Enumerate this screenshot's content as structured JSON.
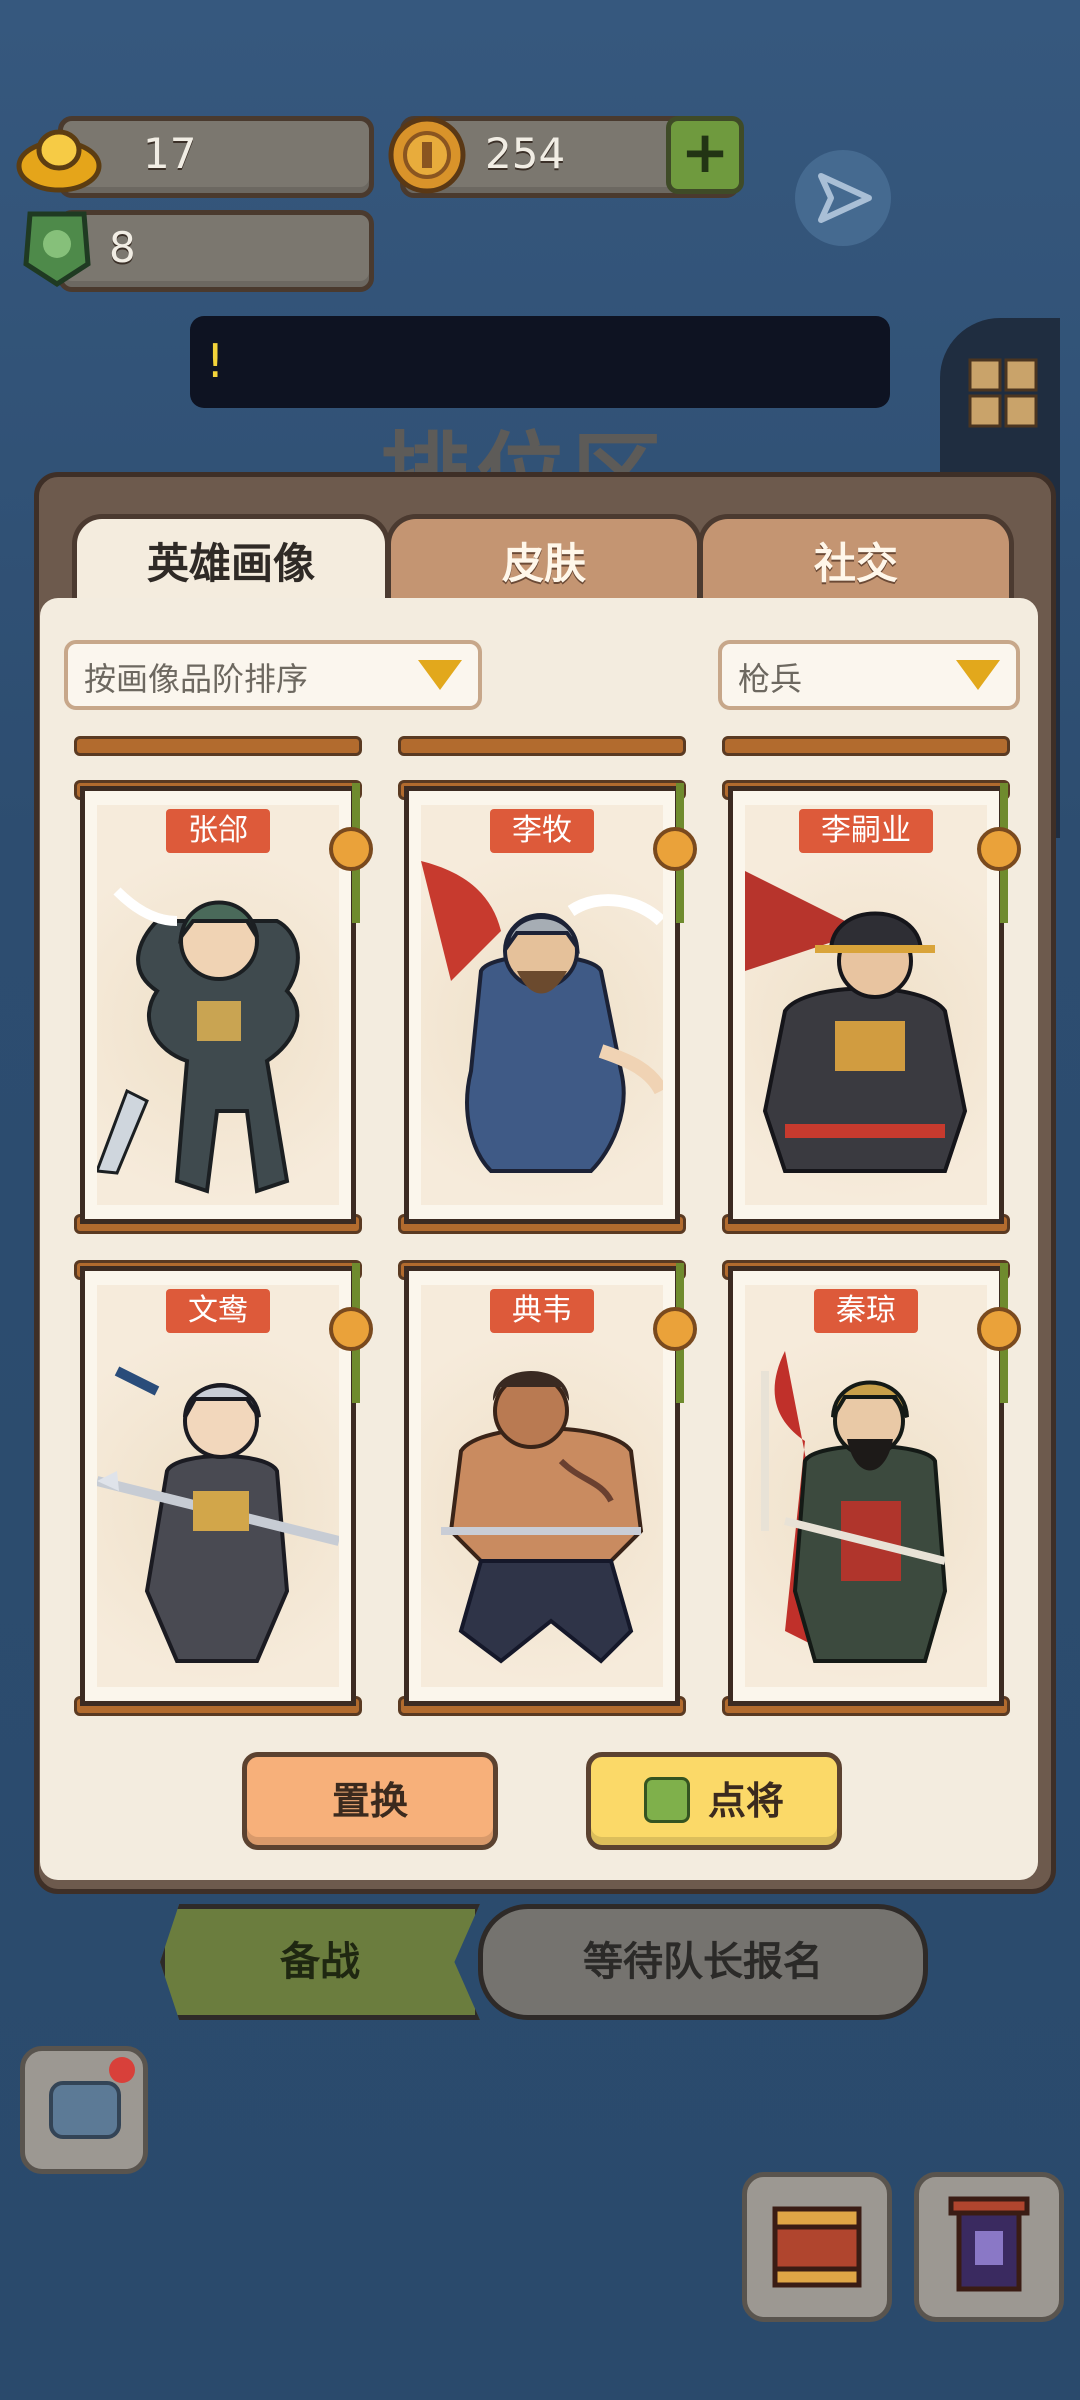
{
  "resources": {
    "gold_ingot": "17",
    "coin": "254",
    "jade": "8"
  },
  "notice": {
    "text": "!"
  },
  "area_title": "排位区",
  "tabs": [
    {
      "label": "英雄画像",
      "active": true
    },
    {
      "label": "皮肤",
      "active": false
    },
    {
      "label": "社交",
      "active": false
    }
  ],
  "filters": {
    "sort": "按画像品阶排序",
    "type": "枪兵"
  },
  "heroes": [
    {
      "name": "张郃"
    },
    {
      "name": "李牧"
    },
    {
      "name": "李嗣业"
    },
    {
      "name": "文鸯"
    },
    {
      "name": "典韦"
    },
    {
      "name": "秦琼"
    }
  ],
  "actions": {
    "replace": "置换",
    "pick": "点将"
  },
  "bottom": {
    "ready": "备战",
    "wait": "等待队长报名"
  },
  "icons": [
    "gold-ingot-icon",
    "coin-icon",
    "plus-icon",
    "jade-icon",
    "send-icon",
    "grid-menu-icon",
    "chat-icon",
    "chest-icon",
    "banner-icon"
  ],
  "colors": {
    "background": "#2e4e72",
    "panel": "#f3ecdf",
    "name_tag": "#dd5a3a",
    "pick_button": "#fbd968",
    "replace_button": "#f7b07a"
  }
}
